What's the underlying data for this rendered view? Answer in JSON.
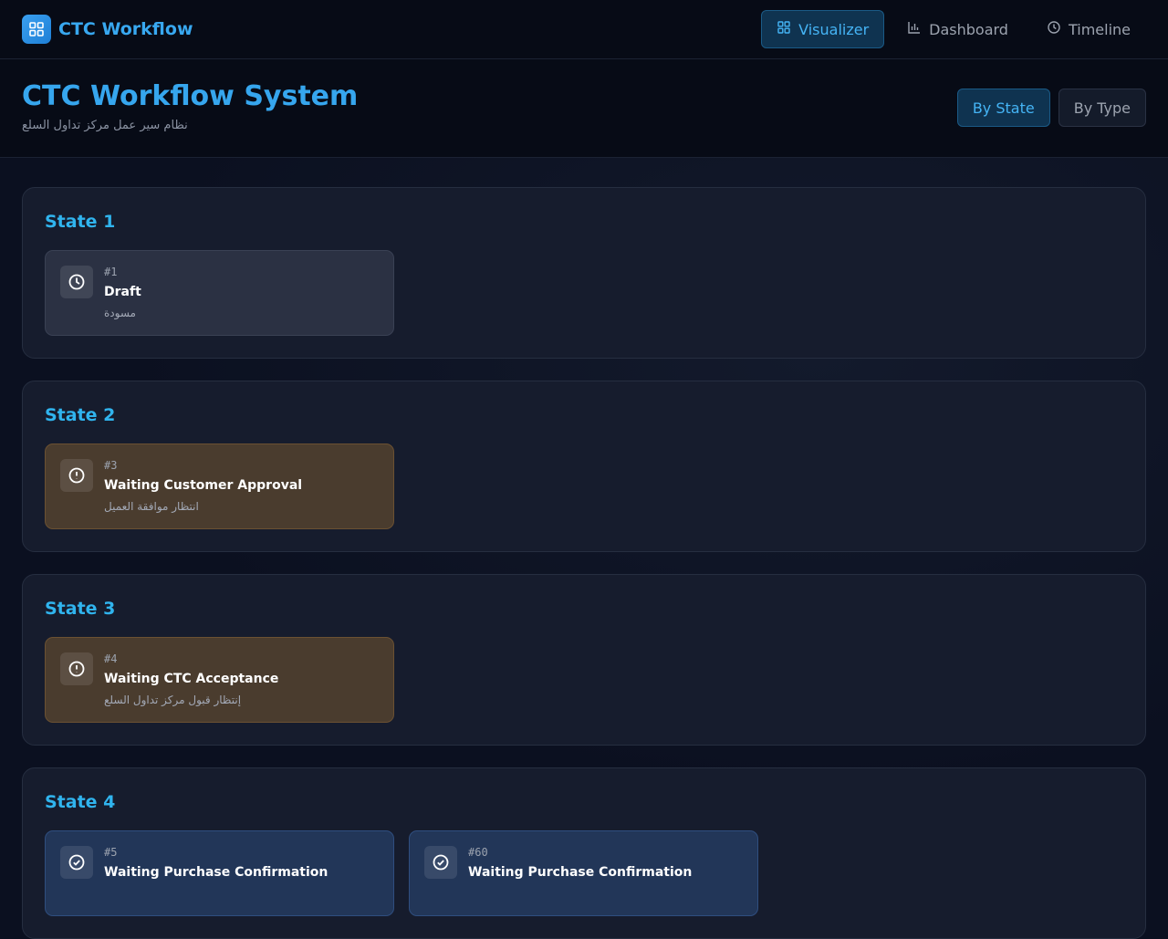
{
  "app": {
    "name": "CTC Workflow"
  },
  "nav": [
    {
      "label": "Visualizer",
      "icon": "grid-icon",
      "active": true
    },
    {
      "label": "Dashboard",
      "icon": "bar-chart-icon",
      "active": false
    },
    {
      "label": "Timeline",
      "icon": "clock-icon",
      "active": false
    }
  ],
  "header": {
    "title": "CTC Workflow System",
    "subtitle": "نظام سير عمل مركز تداول السلع"
  },
  "view_toggle": {
    "by_state": "By State",
    "by_type": "By Type",
    "active": "by_state"
  },
  "groups": [
    {
      "title": "State 1",
      "cards": [
        {
          "num": "#1",
          "name": "Draft",
          "arabic": "مسودة",
          "icon": "clock-icon",
          "tone": "gray"
        }
      ]
    },
    {
      "title": "State 2",
      "cards": [
        {
          "num": "#3",
          "name": "Waiting Customer Approval",
          "arabic": "انتظار موافقة العميل",
          "icon": "alert-circle-icon",
          "tone": "amber"
        }
      ]
    },
    {
      "title": "State 3",
      "cards": [
        {
          "num": "#4",
          "name": "Waiting CTC Acceptance",
          "arabic": "إنتظار قبول مركز تداول السلع",
          "icon": "alert-circle-icon",
          "tone": "amber"
        }
      ]
    },
    {
      "title": "State 4",
      "cards": [
        {
          "num": "#5",
          "name": "Waiting Purchase Confirmation",
          "arabic": "",
          "icon": "check-circle-icon",
          "tone": "blue"
        },
        {
          "num": "#60",
          "name": "Waiting Purchase Confirmation",
          "arabic": "",
          "icon": "check-circle-icon",
          "tone": "blue"
        }
      ]
    }
  ]
}
